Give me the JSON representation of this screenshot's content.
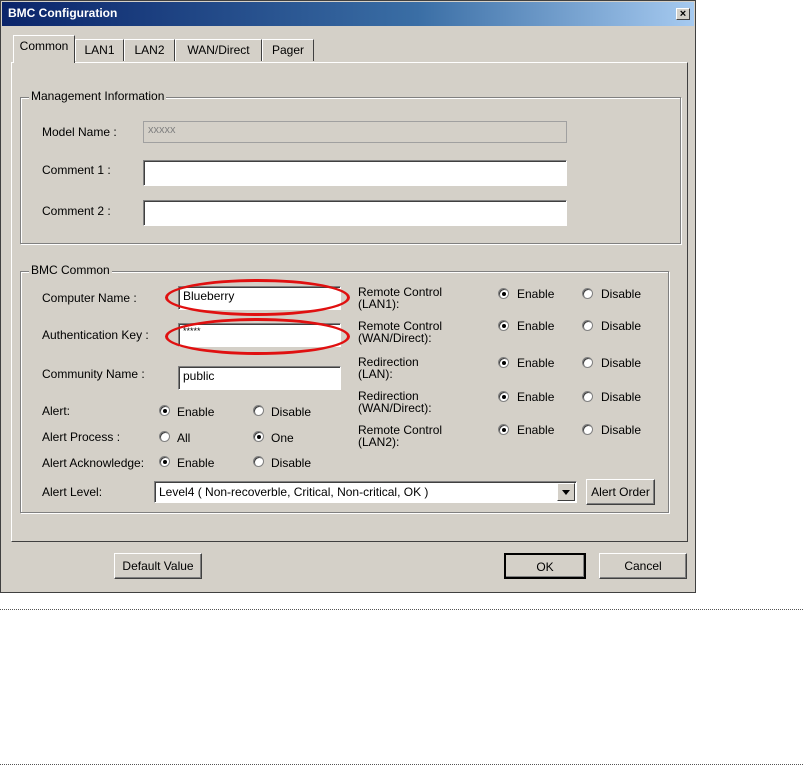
{
  "window": {
    "title": "BMC Configuration",
    "close_label": "×"
  },
  "tabs": [
    {
      "label": "Common",
      "active": true
    },
    {
      "label": "LAN1"
    },
    {
      "label": "LAN2"
    },
    {
      "label": "WAN/Direct"
    },
    {
      "label": "Pager"
    }
  ],
  "management": {
    "group_title": "Management Information",
    "model_name_label": "Model Name :",
    "model_name_value": "xxxxx",
    "comment1_label": "Comment 1 :",
    "comment1_value": "",
    "comment2_label": "Comment 2 :",
    "comment2_value": ""
  },
  "bmc_common": {
    "group_title": "BMC Common",
    "computer_name_label": "Computer Name :",
    "computer_name_value": "Blueberry",
    "auth_key_label": "Authentication Key :",
    "auth_key_value": "*****",
    "community_name_label": "Community Name :",
    "community_name_value": "public",
    "alert_label": "Alert:",
    "alert_process_label": "Alert Process :",
    "alert_ack_label": "Alert Acknowledge:",
    "alert_level_label": "Alert Level:",
    "alert_level_value": "Level4 ( Non-recoverble, Critical, Non-critical, OK )",
    "alert_order_button": "Alert Order",
    "options": {
      "enable": "Enable",
      "disable": "Disable",
      "all": "All",
      "one": "One"
    },
    "selected": {
      "alert": "enable",
      "alert_process": "one",
      "alert_ack": "enable"
    }
  },
  "remote": [
    {
      "label1": "Remote Control",
      "label2": "(LAN1):",
      "selected": "enable"
    },
    {
      "label1": "Remote Control",
      "label2": "(WAN/Direct):",
      "selected": "enable"
    },
    {
      "label1": "Redirection",
      "label2": "(LAN):",
      "selected": "enable"
    },
    {
      "label1": "Redirection",
      "label2": "(WAN/Direct):",
      "selected": "enable"
    },
    {
      "label1": "Remote Control",
      "label2": "(LAN2):",
      "selected": "enable"
    }
  ],
  "buttons": {
    "default_value": "Default Value",
    "ok": "OK",
    "cancel": "Cancel"
  },
  "colors": {
    "dialog_bg": "#d4d0c8",
    "title_bar": "#0a246a",
    "annotation": "#e01010"
  }
}
